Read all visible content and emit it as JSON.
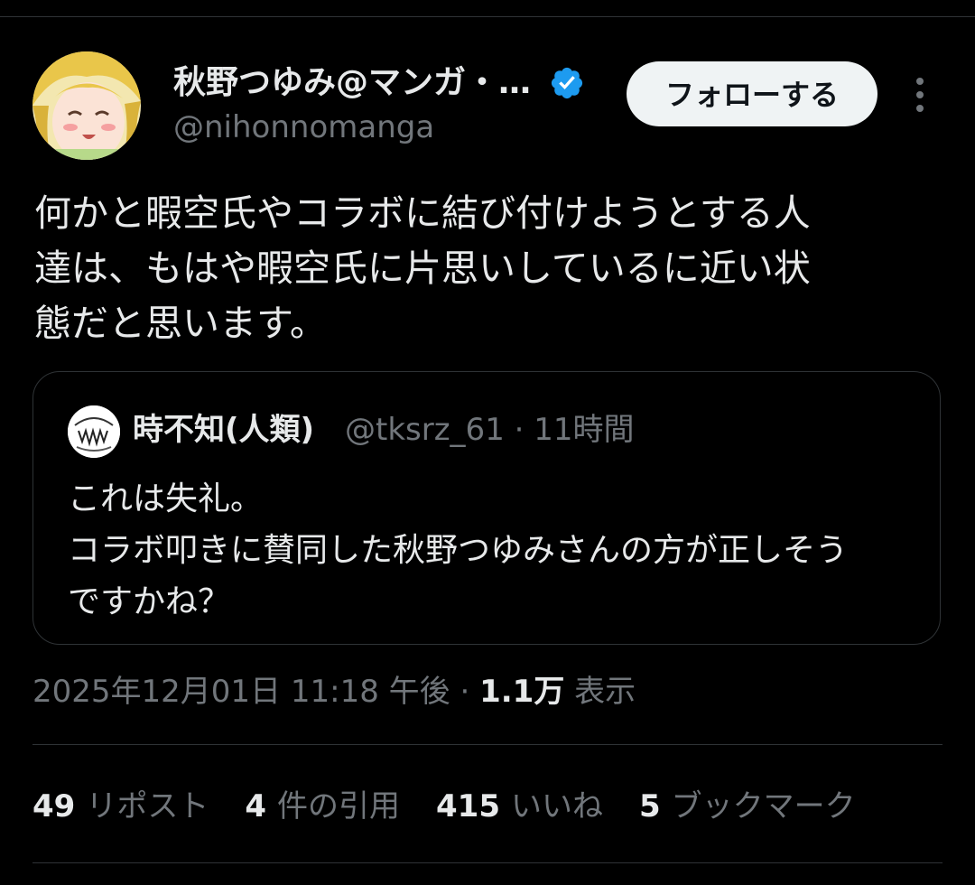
{
  "author": {
    "name": "秋野つゆみ@マンガ・…",
    "handle": "@nihonnomanga",
    "verified": true
  },
  "follow_label": "フォローする",
  "tweet_text": "何かと暇空氏やコラボに結び付けようとする人\n達は、もはや暇空氏に片思いしているに近い状\n態だと思います。",
  "quote": {
    "name": "時不知(人類)",
    "meta": "@tksrz_61 · 11時間",
    "text": "これは失礼。\nコラボ叩きに賛同した秋野つゆみさんの方が正しそう\nですかね？"
  },
  "meta": {
    "timestamp": "2025年12月01日 11:18 午後",
    "separator": " · ",
    "views": "1.1万",
    "views_label": " 表示"
  },
  "stats": [
    {
      "num": "49",
      "label": "リポスト"
    },
    {
      "num": "4",
      "label": "件の引用"
    },
    {
      "num": "415",
      "label": "いいね"
    },
    {
      "num": "5",
      "label": "ブックマーク"
    }
  ],
  "icons": {
    "verified": "verified-badge-icon",
    "more": "more-vertical-icon"
  },
  "colors": {
    "background": "#000000",
    "text": "#e7e9ea",
    "secondary": "#71767b",
    "verified": "#1d9bf0",
    "divider": "#2f3336"
  }
}
